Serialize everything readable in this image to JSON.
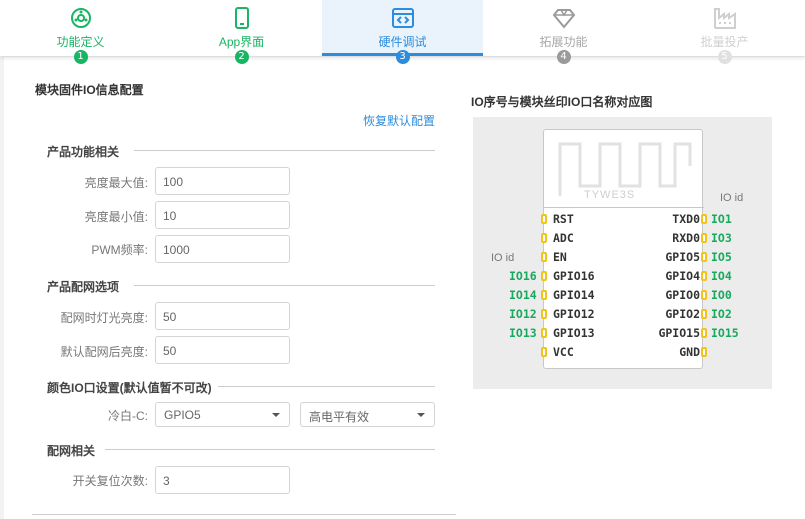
{
  "stepper": {
    "steps": [
      {
        "label": "功能定义",
        "num": "1",
        "icon": "settings-gear-icon"
      },
      {
        "label": "App界面",
        "num": "2",
        "icon": "phone-icon"
      },
      {
        "label": "硬件调试",
        "num": "3",
        "icon": "code-window-icon"
      },
      {
        "label": "拓展功能",
        "num": "4",
        "icon": "diamond-icon"
      },
      {
        "label": "批量投产",
        "num": "5",
        "icon": "factory-icon"
      }
    ]
  },
  "colors": {
    "done": "#18b564",
    "active": "#2d8cdb",
    "pin_pad": "#f0c419",
    "pin_id": "#18a95c"
  },
  "config": {
    "title": "模块固件IO信息配置",
    "restore_default": "恢复默认配置",
    "sections": {
      "product": "产品功能相关",
      "network": "产品配网选项",
      "color_io": "颜色IO口设置(默认值暂不可改)",
      "pairing": "配网相关"
    },
    "fields": {
      "brightness_max": {
        "label": "亮度最大值:",
        "value": "100"
      },
      "brightness_min": {
        "label": "亮度最小值:",
        "value": "10"
      },
      "pwm_freq": {
        "label": "PWM频率:",
        "value": "1000"
      },
      "net_light_brightness": {
        "label": "配网时灯光亮度:",
        "value": "50"
      },
      "default_net_brightness": {
        "label": "默认配网后亮度:",
        "value": "50"
      },
      "cold_white": {
        "label": "冷白-C:",
        "gpio": "GPIO5",
        "level": "高电平有效"
      },
      "reset_count": {
        "label": "开关复位次数:",
        "value": "3"
      }
    }
  },
  "diagram": {
    "title": "IO序号与模块丝印IO口名称对应图",
    "module_name": "TYWE3S",
    "io_id_label": "IO id",
    "left_pins": [
      {
        "name": "RST",
        "id": ""
      },
      {
        "name": "ADC",
        "id": ""
      },
      {
        "name": "EN",
        "id": ""
      },
      {
        "name": "GPIO16",
        "id": "IO16"
      },
      {
        "name": "GPIO14",
        "id": "IO14"
      },
      {
        "name": "GPIO12",
        "id": "IO12"
      },
      {
        "name": "GPIO13",
        "id": "IO13"
      },
      {
        "name": "VCC",
        "id": ""
      }
    ],
    "right_pins": [
      {
        "name": "TXD0",
        "id": "IO1"
      },
      {
        "name": "RXD0",
        "id": "IO3"
      },
      {
        "name": "GPIO5",
        "id": "IO5"
      },
      {
        "name": "GPIO4",
        "id": "IO4"
      },
      {
        "name": "GPIO0",
        "id": "IO0"
      },
      {
        "name": "GPIO2",
        "id": "IO2"
      },
      {
        "name": "GPIO15",
        "id": "IO15"
      },
      {
        "name": "GND",
        "id": ""
      }
    ]
  }
}
